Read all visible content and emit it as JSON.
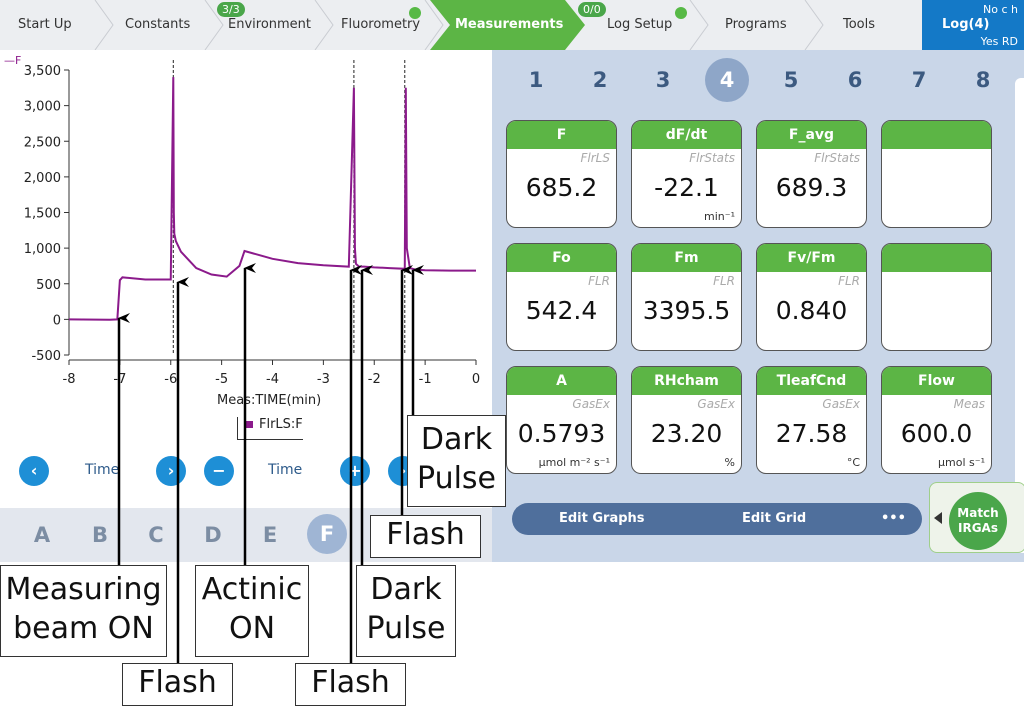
{
  "nav": {
    "tabs": [
      {
        "label": "Start Up"
      },
      {
        "label": "Constants"
      },
      {
        "label": "Environment",
        "badge": "3/3"
      },
      {
        "label": "Fluorometry",
        "dot": true
      },
      {
        "label": "Measurements",
        "active": true
      },
      {
        "label": "Log Setup",
        "badge": "0/0",
        "dot": true
      },
      {
        "label": "Programs"
      },
      {
        "label": "Tools"
      }
    ],
    "log": {
      "top": "No c h",
      "label": "Log(4)",
      "bottom": "Yes RD"
    }
  },
  "graph": {
    "x_title": "Meas:TIME(min)",
    "legend": "FlrLS:F",
    "series_tag": "F",
    "controls": {
      "left_label": "Time",
      "right_label": "Time",
      "prev": "‹",
      "next": "›",
      "minus": "−",
      "plus": "+"
    }
  },
  "chart_data": {
    "type": "line",
    "xlabel": "Meas:TIME(min)",
    "ylabel": "",
    "xlim": [
      -8,
      0
    ],
    "ylim": [
      -500,
      3500
    ],
    "x_ticks": [
      -8,
      -7,
      -6,
      -5,
      -4,
      -3,
      -2,
      -1,
      0
    ],
    "x_tick_labels": [
      "-8",
      "-7",
      "-6",
      "-5",
      "-4",
      "-3",
      "-2",
      "-1",
      "0"
    ],
    "y_ticks": [
      -500,
      0,
      500,
      1000,
      1500,
      2000,
      2500,
      3000,
      3500
    ],
    "y_tick_labels": [
      "-500",
      "0",
      "500",
      "1,000",
      "1,500",
      "2,000",
      "2,500",
      "3,000",
      "3,500"
    ],
    "series": [
      {
        "name": "FlrLS:F",
        "x": [
          -8,
          -7.2,
          -7.05,
          -7.0,
          -6.95,
          -6.5,
          -6.0,
          -5.95,
          -5.94,
          -5.93,
          -5.9,
          -5.8,
          -5.5,
          -5.2,
          -4.9,
          -4.65,
          -4.55,
          -4.4,
          -4.0,
          -3.5,
          -3.0,
          -2.5,
          -2.4,
          -2.38,
          -2.36,
          -2.3,
          -2.2,
          -2.0,
          -1.7,
          -1.4,
          -1.38,
          -1.36,
          -1.3,
          -1.2,
          -1.0,
          -0.5,
          0
        ],
        "y": [
          0,
          -5,
          0,
          550,
          590,
          560,
          560,
          3400,
          1500,
          1200,
          1100,
          950,
          720,
          630,
          600,
          750,
          960,
          930,
          850,
          790,
          760,
          740,
          3250,
          1000,
          780,
          740,
          740,
          730,
          720,
          710,
          3250,
          1000,
          720,
          700,
          690,
          685,
          685
        ]
      }
    ],
    "vlines": [
      -5.95,
      -2.4,
      -1.4
    ]
  },
  "letters": [
    "A",
    "B",
    "C",
    "D",
    "E",
    "F"
  ],
  "active_letter": "F",
  "grid_numbers": [
    "1",
    "2",
    "3",
    "4",
    "5",
    "6",
    "7",
    "8"
  ],
  "active_number": "4",
  "cells": [
    {
      "title": "F",
      "src": "FlrLS",
      "value": "685.2",
      "unit": ""
    },
    {
      "title": "dF/dt",
      "src": "FlrStats",
      "value": "-22.1",
      "unit": "min⁻¹"
    },
    {
      "title": "F_avg",
      "src": "FlrStats",
      "value": "689.3",
      "unit": ""
    },
    {
      "title": "",
      "src": "",
      "value": "",
      "unit": ""
    },
    {
      "title": "Fo",
      "src": "FLR",
      "value": "542.4",
      "unit": ""
    },
    {
      "title": "Fm",
      "src": "FLR",
      "value": "3395.5",
      "unit": ""
    },
    {
      "title": "Fv/Fm",
      "src": "FLR",
      "value": "0.840",
      "unit": ""
    },
    {
      "title": "",
      "src": "",
      "value": "",
      "unit": ""
    },
    {
      "title": "A",
      "src": "GasEx",
      "value": "0.5793",
      "unit": "µmol m⁻² s⁻¹"
    },
    {
      "title": "RHcham",
      "src": "GasEx",
      "value": "23.20",
      "unit": "%"
    },
    {
      "title": "TleafCnd",
      "src": "GasEx",
      "value": "27.58",
      "unit": "°C"
    },
    {
      "title": "Flow",
      "src": "Meas",
      "value": "600.0",
      "unit": "µmol s⁻¹"
    }
  ],
  "editbar": {
    "edit_graphs": "Edit Graphs",
    "edit_grid": "Edit Grid",
    "more": "•••"
  },
  "match": {
    "line1": "Match",
    "line2": "IRGAs"
  },
  "callouts": {
    "measuring_beam": [
      "Measuring",
      "beam ON"
    ],
    "flash1": [
      "Flash"
    ],
    "actinic": [
      "Actinic",
      "ON"
    ],
    "flash2": [
      "Flash"
    ],
    "dark_pulse1": [
      "Dark",
      "Pulse"
    ],
    "flash3": [
      "Flash"
    ],
    "dark_pulse2": [
      "Dark",
      "Pulse"
    ]
  },
  "colors": {
    "accent_green": "#5cb545",
    "nav_blue": "#1479c7",
    "trace": "#8b1a8b",
    "panel": "#c9d6e8"
  }
}
